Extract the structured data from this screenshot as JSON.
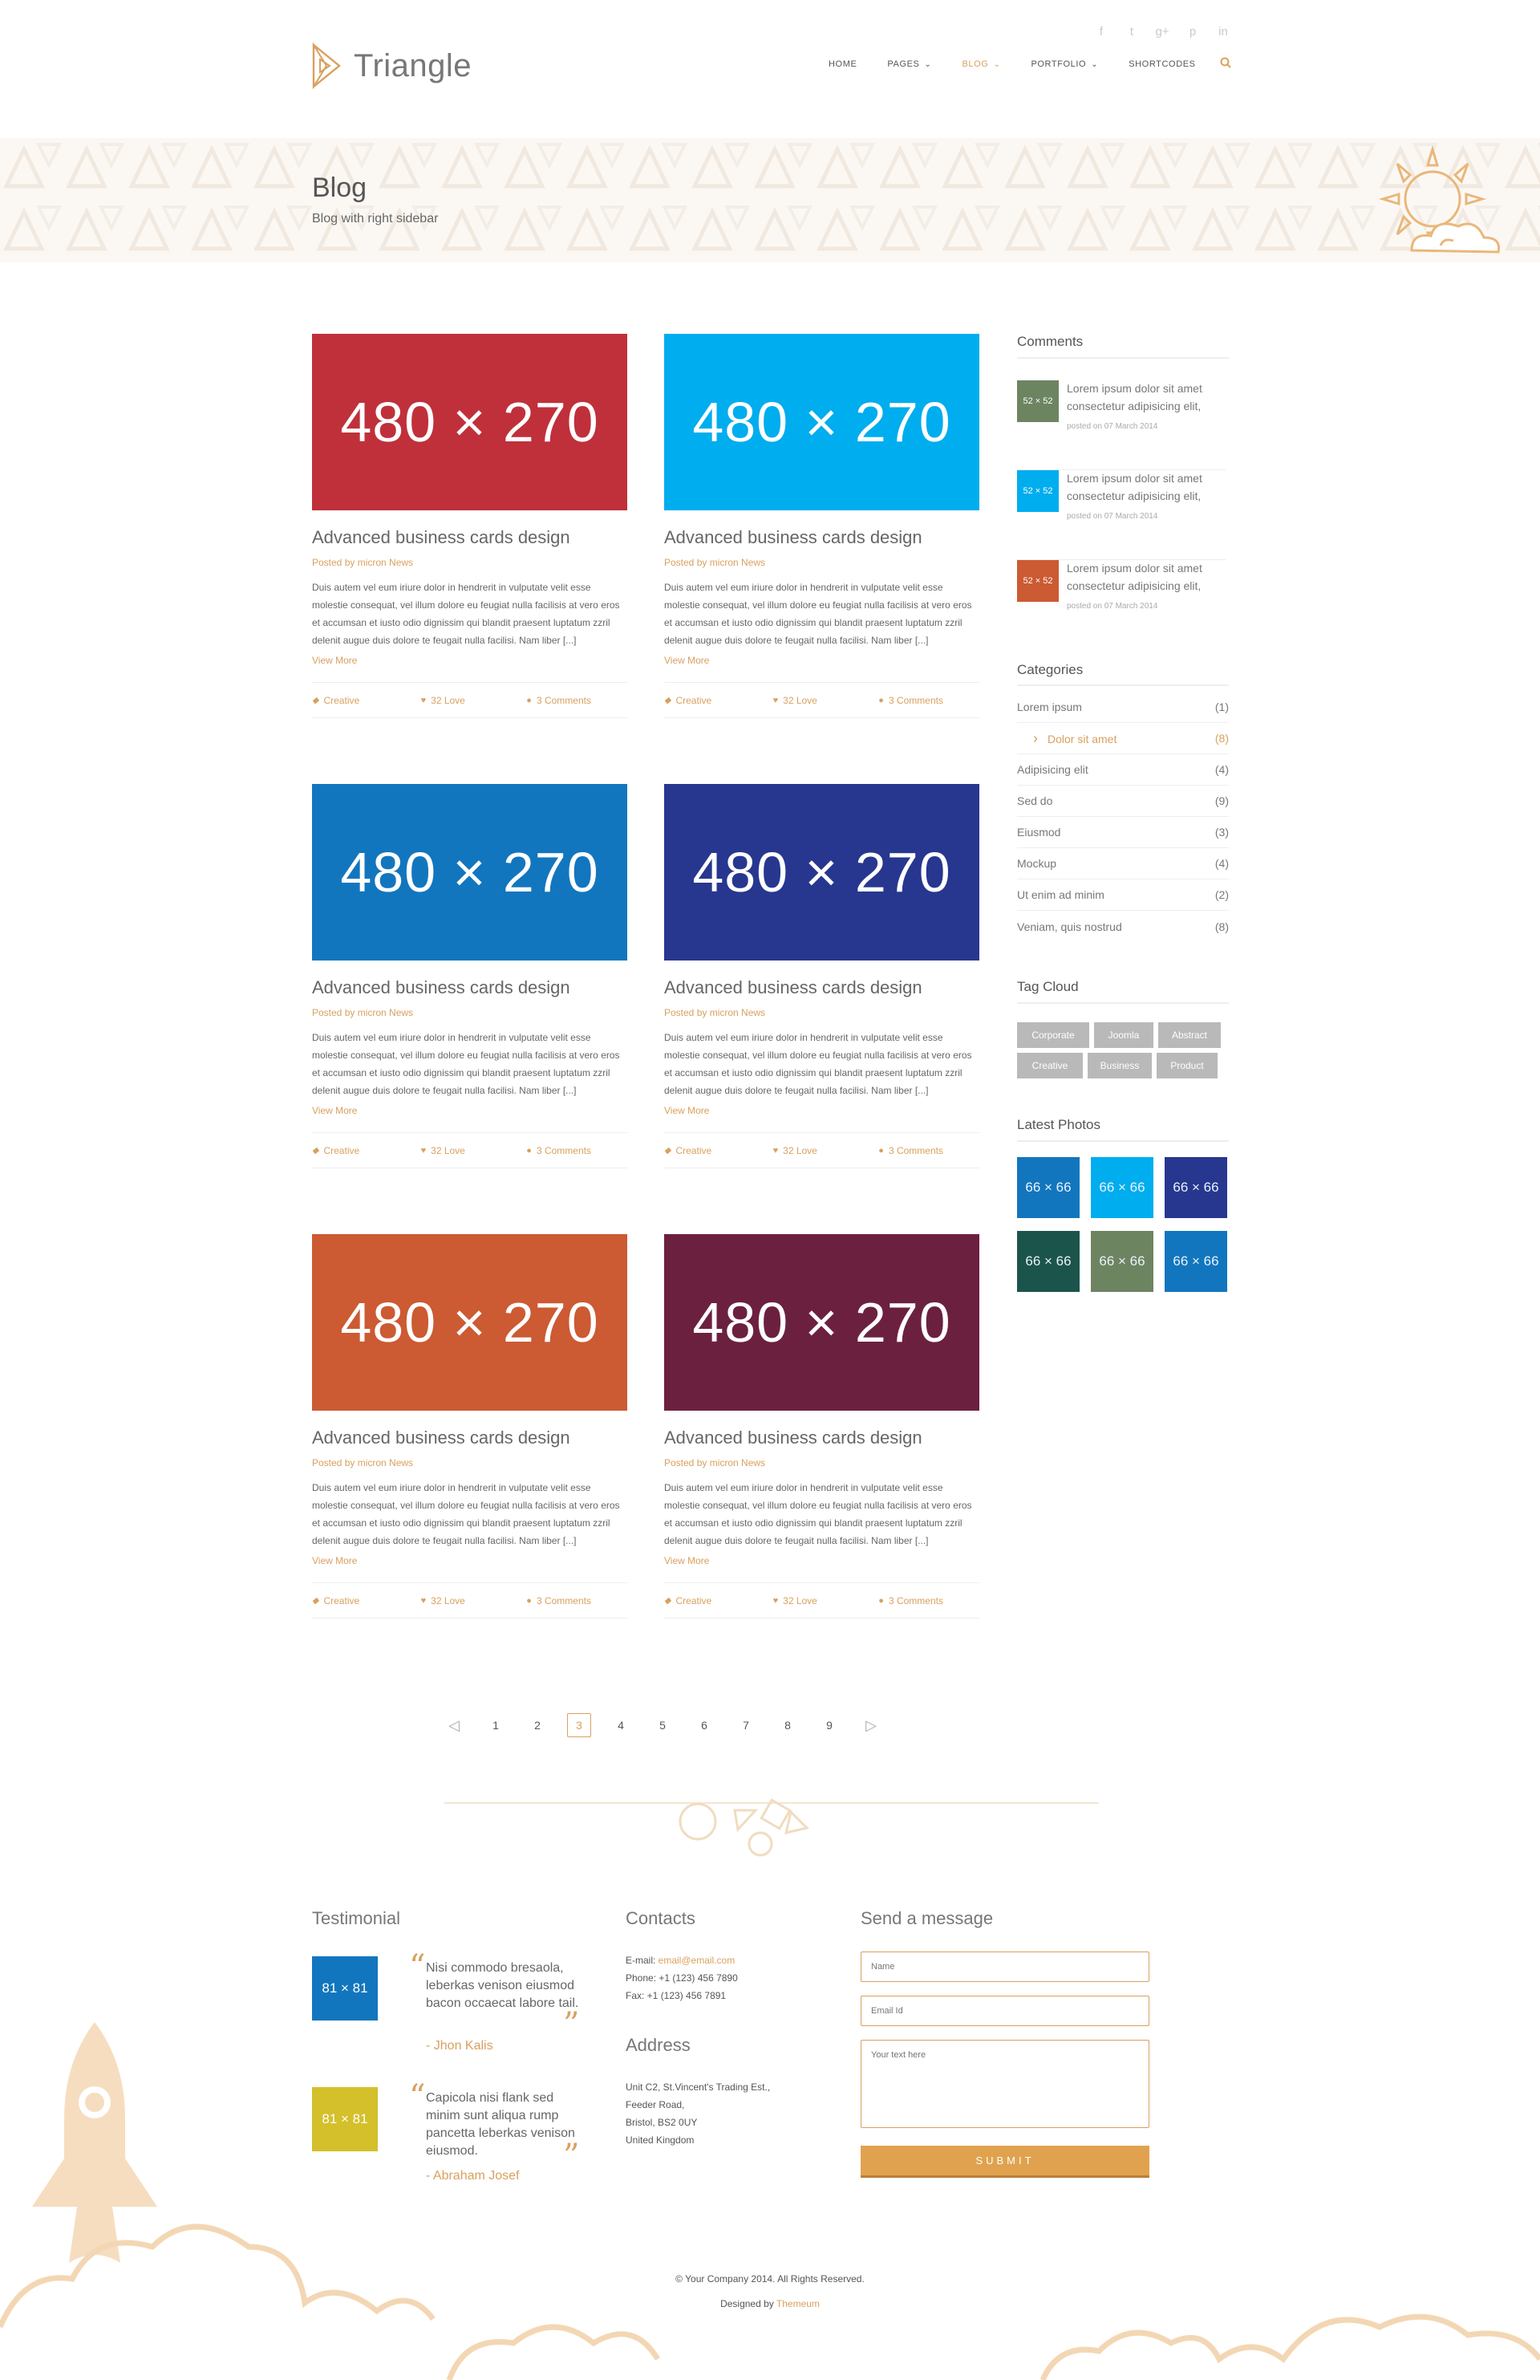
{
  "brand": {
    "name": "Triangle"
  },
  "social": [
    "f",
    "t",
    "g+",
    "p",
    "in"
  ],
  "nav": [
    {
      "label": "HOME",
      "active": false,
      "dropdown": false
    },
    {
      "label": "PAGES",
      "active": false,
      "dropdown": true
    },
    {
      "label": "BLOG",
      "active": true,
      "dropdown": true
    },
    {
      "label": "PORTFOLIO",
      "active": false,
      "dropdown": true
    },
    {
      "label": "SHORTCODES",
      "active": false,
      "dropdown": false
    }
  ],
  "banner": {
    "title": "Blog",
    "subtitle": "Blog with right sidebar"
  },
  "posts": [
    {
      "thumb": "480 × 270",
      "color": "#c0303a",
      "title": "Advanced business cards design",
      "by": "Posted by micron News",
      "excerpt": "Duis autem vel eum iriure dolor in hendrerit in vulputate velit esse molestie consequat, vel illum dolore eu feugiat nulla facilisis at vero eros et accumsan et iusto odio dignissim qui blandit praesent luptatum zzril delenit augue duis dolore te feugait nulla facilisi. Nam liber [...]",
      "more": "View More",
      "category": "Creative",
      "love": "32 Love",
      "comments": "3 Comments"
    },
    {
      "thumb": "480 × 270",
      "color": "#00adee",
      "title": "Advanced business cards design",
      "by": "Posted by micron News",
      "excerpt": "Duis autem vel eum iriure dolor in hendrerit in vulputate velit esse molestie consequat, vel illum dolore eu feugiat nulla facilisis at vero eros et accumsan et iusto odio dignissim qui blandit praesent luptatum zzril delenit augue duis dolore te feugait nulla facilisi. Nam liber [...]",
      "more": "View More",
      "category": "Creative",
      "love": "32 Love",
      "comments": "3 Comments"
    },
    {
      "thumb": "480 × 270",
      "color": "#1276be",
      "title": "Advanced business cards design",
      "by": "Posted by micron News",
      "excerpt": "Duis autem vel eum iriure dolor in hendrerit in vulputate velit esse molestie consequat, vel illum dolore eu feugiat nulla facilisis at vero eros et accumsan et iusto odio dignissim qui blandit praesent luptatum zzril delenit augue duis dolore te feugait nulla facilisi. Nam liber [...]",
      "more": "View More",
      "category": "Creative",
      "love": "32 Love",
      "comments": "3 Comments"
    },
    {
      "thumb": "480 × 270",
      "color": "#27378f",
      "title": "Advanced business cards design",
      "by": "Posted by micron News",
      "excerpt": "Duis autem vel eum iriure dolor in hendrerit in vulputate velit esse molestie consequat, vel illum dolore eu feugiat nulla facilisis at vero eros et accumsan et iusto odio dignissim qui blandit praesent luptatum zzril delenit augue duis dolore te feugait nulla facilisi. Nam liber [...]",
      "more": "View More",
      "category": "Creative",
      "love": "32 Love",
      "comments": "3 Comments"
    },
    {
      "thumb": "480 × 270",
      "color": "#cc5a32",
      "title": "Advanced business cards design",
      "by": "Posted by micron News",
      "excerpt": "Duis autem vel eum iriure dolor in hendrerit in vulputate velit esse molestie consequat, vel illum dolore eu feugiat nulla facilisis at vero eros et accumsan et iusto odio dignissim qui blandit praesent luptatum zzril delenit augue duis dolore te feugait nulla facilisi. Nam liber [...]",
      "more": "View More",
      "category": "Creative",
      "love": "32 Love",
      "comments": "3 Comments"
    },
    {
      "thumb": "480 × 270",
      "color": "#6c2040",
      "title": "Advanced business cards design",
      "by": "Posted by micron News",
      "excerpt": "Duis autem vel eum iriure dolor in hendrerit in vulputate velit esse molestie consequat, vel illum dolore eu feugiat nulla facilisis at vero eros et accumsan et iusto odio dignissim qui blandit praesent luptatum zzril delenit augue duis dolore te feugait nulla facilisi. Nam liber [...]",
      "more": "View More",
      "category": "Creative",
      "love": "32 Love",
      "comments": "3 Comments"
    }
  ],
  "sidebar": {
    "comments_title": "Comments",
    "comments": [
      {
        "avatar": "52 × 52",
        "color": "#6d8461",
        "text": "Lorem ipsum dolor sit amet consectetur adipisicing elit,",
        "date": "posted on 07 March 2014"
      },
      {
        "avatar": "52 × 52",
        "color": "#00adee",
        "text": "Lorem ipsum dolor sit amet consectetur adipisicing elit,",
        "date": "posted on 07 March 2014"
      },
      {
        "avatar": "52 × 52",
        "color": "#cc5a32",
        "text": "Lorem ipsum dolor sit amet consectetur adipisicing elit,",
        "date": "posted on 07 March 2014"
      }
    ],
    "categories_title": "Categories",
    "categories": [
      {
        "name": "Lorem ipsum",
        "count": "(1)",
        "sub": false
      },
      {
        "name": "Dolor sit amet",
        "count": "(8)",
        "sub": true
      },
      {
        "name": "Adipisicing elit",
        "count": "(4)",
        "sub": false
      },
      {
        "name": "Sed do",
        "count": "(9)",
        "sub": false
      },
      {
        "name": "Eiusmod",
        "count": "(3)",
        "sub": false
      },
      {
        "name": "Mockup",
        "count": "(4)",
        "sub": false
      },
      {
        "name": "Ut enim ad minim",
        "count": "(2)",
        "sub": false
      },
      {
        "name": "Veniam, quis nostrud",
        "count": "(8)",
        "sub": false
      }
    ],
    "tags_title": "Tag Cloud",
    "tags": [
      "Corporate",
      "Joomla",
      "Abstract",
      "Creative",
      "Business",
      "Product"
    ],
    "photos_title": "Latest Photos",
    "photos": [
      {
        "label": "66 × 66",
        "color": "#1276be"
      },
      {
        "label": "66 × 66",
        "color": "#00adee"
      },
      {
        "label": "66 × 66",
        "color": "#27378f"
      },
      {
        "label": "66 × 66",
        "color": "#1b544a"
      },
      {
        "label": "66 × 66",
        "color": "#6d8461"
      },
      {
        "label": "66 × 66",
        "color": "#1276be"
      }
    ]
  },
  "pagination": {
    "pages": [
      "1",
      "2",
      "3",
      "4",
      "5",
      "6",
      "7",
      "8",
      "9"
    ],
    "current": "3",
    "prev": "◁",
    "next": "▷"
  },
  "footer": {
    "testimonial_title": "Testimonial",
    "testimonials": [
      {
        "img": "81 × 81",
        "color": "#1276be",
        "quote": "Nisi commodo bresaola, leberkas venison eiusmod bacon occaecat labore tail.",
        "author": "- Jhon Kalis"
      },
      {
        "img": "81 × 81",
        "color": "#d4c02b",
        "quote": "Capicola nisi flank sed minim sunt aliqua rump pancetta leberkas venison eiusmod.",
        "author": "- Abraham Josef"
      }
    ],
    "contacts_title": "Contacts",
    "email_label": "E-mail: ",
    "email": "email@email.com",
    "phone": "Phone: +1 (123) 456 7890",
    "fax": "Fax: +1 (123) 456 7891",
    "address_title": "Address",
    "address": [
      "Unit C2, St.Vincent's Trading Est.,",
      "Feeder Road,",
      "Bristol, BS2 0UY",
      "United Kingdom"
    ],
    "message_title": "Send a message",
    "name_placeholder": "Name",
    "email_placeholder": "Email Id",
    "text_placeholder": "Your text here",
    "submit": "SUBMIT",
    "copyright": "© Your Company 2014. All Rights Reserved.",
    "designed_by": "Designed by ",
    "designer": "Themeum"
  },
  "colors": {
    "accent": "#d9a05e",
    "button": "#e0a24e"
  },
  "icons": {
    "search": "search-icon",
    "tag": "tag-icon",
    "heart": "heart-icon",
    "comment": "comment-icon"
  }
}
